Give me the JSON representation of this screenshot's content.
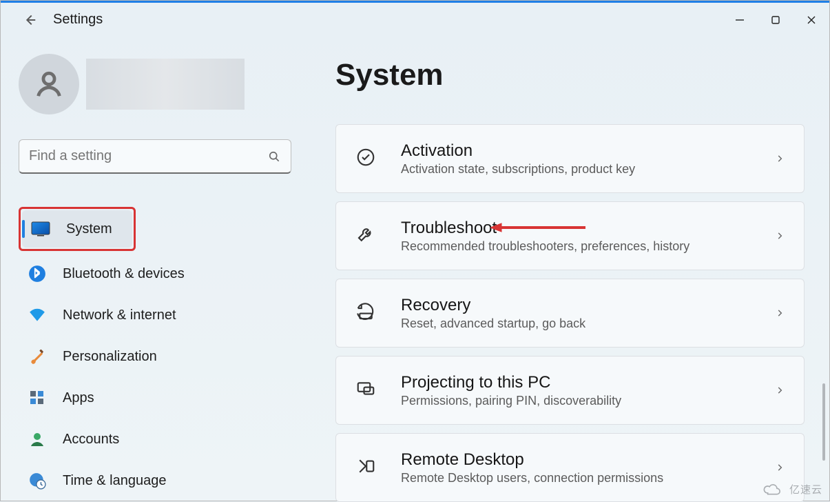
{
  "app_title": "Settings",
  "page_title": "System",
  "search": {
    "placeholder": "Find a setting"
  },
  "nav": {
    "items": [
      {
        "label": "System",
        "icon": "display-icon",
        "selected": true
      },
      {
        "label": "Bluetooth & devices",
        "icon": "bluetooth-icon"
      },
      {
        "label": "Network & internet",
        "icon": "wifi-icon"
      },
      {
        "label": "Personalization",
        "icon": "brush-icon"
      },
      {
        "label": "Apps",
        "icon": "apps-icon"
      },
      {
        "label": "Accounts",
        "icon": "person-icon"
      },
      {
        "label": "Time & language",
        "icon": "globe-clock-icon"
      }
    ]
  },
  "cards": [
    {
      "title": "Activation",
      "sub": "Activation state, subscriptions, product key",
      "icon": "check-circle-icon"
    },
    {
      "title": "Troubleshoot",
      "sub": "Recommended troubleshooters, preferences, history",
      "icon": "wrench-icon",
      "pointed": true
    },
    {
      "title": "Recovery",
      "sub": "Reset, advanced startup, go back",
      "icon": "recovery-icon"
    },
    {
      "title": "Projecting to this PC",
      "sub": "Permissions, pairing PIN, discoverability",
      "icon": "project-icon"
    },
    {
      "title": "Remote Desktop",
      "sub": "Remote Desktop users, connection permissions",
      "icon": "remote-icon"
    }
  ],
  "annotations": {
    "highlighted_nav_item": "System",
    "arrow_target_card": "Troubleshoot"
  },
  "watermark": "亿速云"
}
